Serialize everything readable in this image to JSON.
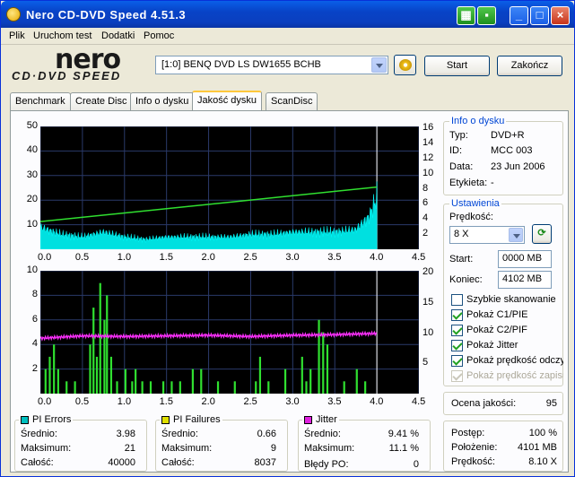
{
  "window": {
    "title": "Nero CD-DVD Speed 4.51.3"
  },
  "menu": [
    "Plik",
    "Uruchom test",
    "Dodatki",
    "Pomoc"
  ],
  "logo": {
    "top": "nero",
    "bottom": "CD·DVD SPEED"
  },
  "drive": {
    "selected": "[1:0]  BENQ DVD LS DW1655 BCHB"
  },
  "buttons": {
    "start": "Start",
    "end": "Zakończ"
  },
  "tabs": [
    "Benchmark",
    "Create Disc",
    "Info o dysku",
    "Jakość dysku",
    "ScanDisc"
  ],
  "active_tab": "Jakość dysku",
  "disc_info": {
    "title": "Info o dysku",
    "type_label": "Typ:",
    "type": "DVD+R",
    "id_label": "ID:",
    "id": "MCC 003",
    "date_label": "Data:",
    "date": "23 Jun 2006",
    "label_label": "Etykieta:",
    "label": "-"
  },
  "settings": {
    "title": "Ustawienia",
    "speed_label": "Prędkość:",
    "speed": "8 X",
    "start_label": "Start:",
    "start": "0000 MB",
    "end_label": "Koniec:",
    "end": "4102 MB",
    "checks": [
      {
        "label": "Szybkie skanowanie",
        "checked": false,
        "enabled": true
      },
      {
        "label": "Pokaż C1/PIE",
        "checked": true,
        "enabled": true
      },
      {
        "label": "Pokaż C2/PIF",
        "checked": true,
        "enabled": true
      },
      {
        "label": "Pokaż Jitter",
        "checked": true,
        "enabled": true
      },
      {
        "label": "Pokaż prędkość odczytu",
        "checked": true,
        "enabled": true
      },
      {
        "label": "Pokaż prędkość zapisu",
        "checked": true,
        "enabled": false
      }
    ]
  },
  "quality": {
    "label": "Ocena jakości:",
    "value": "95"
  },
  "progress": {
    "progress_label": "Postęp:",
    "progress": "100 %",
    "position_label": "Położenie:",
    "position": "4101 MB",
    "speed_label": "Prędkość:",
    "speed": "8.10 X"
  },
  "pi_errors": {
    "title": "PI Errors",
    "color": "#00c0c0",
    "avg_label": "Średnio:",
    "avg": "3.98",
    "max_label": "Maksimum:",
    "max": "21",
    "total_label": "Całość:",
    "total": "40000"
  },
  "pi_failures": {
    "title": "PI Failures",
    "color": "#e0e000",
    "avg_label": "Średnio:",
    "avg": "0.66",
    "max_label": "Maksimum:",
    "max": "9",
    "total_label": "Całość:",
    "total": "8037"
  },
  "jitter": {
    "title": "Jitter",
    "color": "#e020e0",
    "avg_label": "Średnio:",
    "avg": "9.41 %",
    "max_label": "Maksimum:",
    "max": "11.1 %",
    "po_label": "Błędy PO:",
    "po": "0"
  },
  "chart_data": [
    {
      "type": "area",
      "series": [
        {
          "values_desc": "PI Errors",
          "color": "#00ffff"
        },
        {
          "values_desc": "read speed",
          "color": "#00ff00"
        }
      ],
      "x_ticks": [
        "0.0",
        "0.5",
        "1.0",
        "1.5",
        "2.0",
        "2.5",
        "3.0",
        "3.5",
        "4.0",
        "4.5"
      ],
      "y_left_ticks": [
        "50",
        "40",
        "30",
        "20",
        "10"
      ],
      "y_right_ticks": [
        "16",
        "14",
        "12",
        "10",
        "8",
        "6",
        "4",
        "2"
      ],
      "xlim": [
        0,
        4.5
      ],
      "ylim": [
        0,
        50
      ],
      "speed": {
        "x": [
          0,
          4.0
        ],
        "y": [
          3.6,
          8.1
        ]
      },
      "pie": {
        "x": [
          0,
          0.25,
          0.5,
          0.75,
          1.0,
          1.25,
          1.5,
          1.75,
          2.0,
          2.25,
          2.5,
          2.75,
          3.0,
          3.25,
          3.5,
          3.75,
          3.9,
          4.0
        ],
        "y": [
          9,
          6,
          5,
          7,
          5,
          4,
          5,
          5,
          5,
          5,
          6,
          6,
          7,
          7,
          7,
          8,
          13,
          21
        ]
      }
    },
    {
      "type": "bar",
      "series": [
        {
          "values_desc": "PI Failures",
          "color": "#00ff00"
        },
        {
          "values_desc": "Jitter",
          "color": "#ff00ff"
        }
      ],
      "x_ticks": [
        "0.0",
        "0.5",
        "1.0",
        "1.5",
        "2.0",
        "2.5",
        "3.0",
        "3.5",
        "4.0",
        "4.5"
      ],
      "y_left_ticks": [
        "10",
        "8",
        "6",
        "4",
        "2"
      ],
      "y_right_ticks": [
        "20",
        "15",
        "10",
        "5"
      ],
      "xlim": [
        0,
        4.5
      ],
      "ylim": [
        0,
        10
      ],
      "pif": {
        "x": [
          0.05,
          0.1,
          0.15,
          0.2,
          0.3,
          0.4,
          0.58,
          0.62,
          0.66,
          0.7,
          0.75,
          0.78,
          0.83,
          0.9,
          1.0,
          1.08,
          1.12,
          1.2,
          1.3,
          1.45,
          1.55,
          1.65,
          1.8,
          1.9,
          2.1,
          2.3,
          2.55,
          2.6,
          2.7,
          2.9,
          3.1,
          3.15,
          3.2,
          3.3,
          3.35,
          3.4,
          3.6,
          3.75,
          3.85
        ],
        "y": [
          2,
          3,
          4,
          2,
          1,
          1,
          4,
          7,
          3,
          9,
          6,
          8,
          3,
          1,
          2,
          1,
          2,
          1,
          1,
          1,
          1,
          1,
          2,
          2,
          1,
          1,
          1,
          3,
          1,
          2,
          3,
          1,
          2,
          6,
          5,
          4,
          1,
          2,
          1
        ]
      },
      "jitter": {
        "x": [
          0,
          0.5,
          1.0,
          1.5,
          2.0,
          2.5,
          3.0,
          3.5,
          4.0
        ],
        "y": [
          9.0,
          9.4,
          9.3,
          9.4,
          9.5,
          9.3,
          9.5,
          9.6,
          9.8
        ]
      }
    }
  ]
}
